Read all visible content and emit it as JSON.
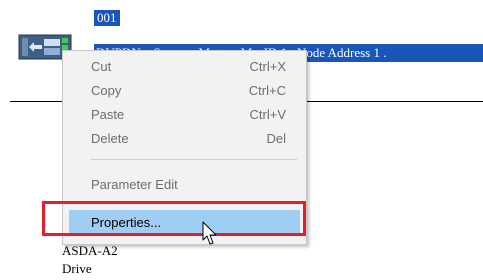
{
  "node": {
    "id": "001",
    "description": "DVPDNet Scanner Master, MacID 1 , Node Address 1 .",
    "device_model": "ASDA-A2",
    "device_type": "Drive"
  },
  "context_menu": {
    "items": [
      {
        "label": "Cut",
        "shortcut": "Ctrl+X"
      },
      {
        "label": "Copy",
        "shortcut": "Ctrl+C"
      },
      {
        "label": "Paste",
        "shortcut": "Ctrl+V"
      },
      {
        "label": "Delete",
        "shortcut": "Del"
      },
      {
        "label": "Parameter Edit",
        "shortcut": ""
      },
      {
        "label": "Properties...",
        "shortcut": ""
      }
    ],
    "selected_index": 5
  },
  "colors": {
    "selection": "#1a56b8",
    "menu_hover": "#9fcdf3",
    "annotation_box": "#e0202e"
  },
  "icons": [
    "device-module-icon",
    "mouse-pointer-icon"
  ]
}
